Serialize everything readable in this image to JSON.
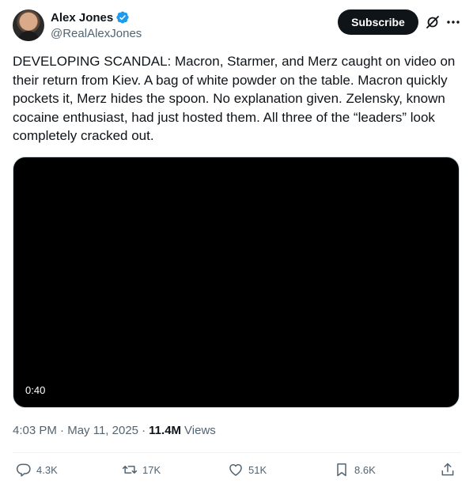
{
  "author": {
    "display_name": "Alex Jones",
    "handle": "@RealAlexJones",
    "verified_icon": "verified-badge-icon"
  },
  "header": {
    "subscribe_label": "Subscribe",
    "grok_icon": "grok-icon",
    "more_icon": "more-icon"
  },
  "tweet": {
    "text": "DEVELOPING SCANDAL: Macron, Starmer, and Merz caught on video on their return from Kiev. A bag of white powder on the table. Macron quickly pockets it, Merz hides the spoon. No explanation given. Zelensky, known cocaine enthusiast, had just hosted them. All three of the “leaders” look completely cracked out."
  },
  "video": {
    "duration": "0:40"
  },
  "meta": {
    "time": "4:03 PM",
    "separator": "·",
    "date": "May 11, 2025",
    "views_count": "11.4M",
    "views_label": "Views"
  },
  "actions": {
    "replies": "4.3K",
    "reposts": "17K",
    "likes": "51K",
    "bookmarks": "8.6K"
  },
  "colors": {
    "text_primary": "#0f1419",
    "text_secondary": "#536471",
    "verified_blue": "#1d9bf0",
    "divider": "#eff3f4"
  }
}
